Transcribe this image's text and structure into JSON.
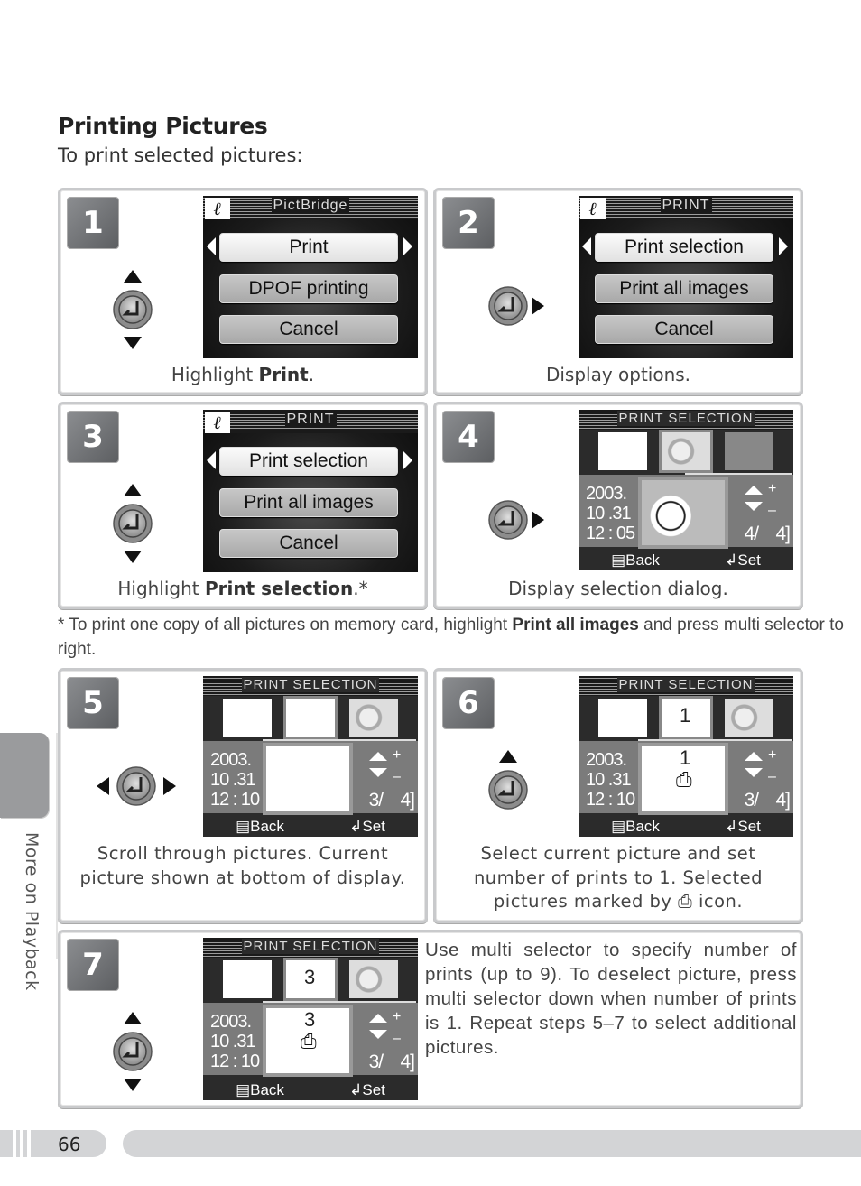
{
  "page": {
    "title": "Printing Pictures",
    "subtitle": "To print selected pictures:",
    "side_tab_label": "More on Playback",
    "page_number": "66"
  },
  "icons": {
    "pictbridge_logo": "pictbridge-icon",
    "multi_selector": "multi-selector-icon",
    "print_mark_glyph": "⎙",
    "back_glyph": "▤",
    "set_glyph": "↵"
  },
  "steps": [
    {
      "number": "1",
      "selector_arrows": [
        "up",
        "down"
      ],
      "screen": {
        "header": "PictBridge",
        "items": [
          "Print",
          "DPOF printing",
          "Cancel"
        ],
        "selected": 0
      },
      "caption_pre": "Highlight ",
      "caption_bold": "Print",
      "caption_post": "."
    },
    {
      "number": "2",
      "selector_arrows": [
        "right"
      ],
      "screen": {
        "header": "PRINT",
        "items": [
          "Print selection",
          "Print all images",
          "Cancel"
        ],
        "selected": 0
      },
      "caption_pre": "Display options.",
      "caption_bold": "",
      "caption_post": ""
    },
    {
      "number": "3",
      "selector_arrows": [
        "up",
        "down"
      ],
      "screen": {
        "header": "PRINT",
        "items": [
          "Print selection",
          "Print all images",
          "Cancel"
        ],
        "selected": 0
      },
      "caption_pre": "Highlight ",
      "caption_bold": "Print selection",
      "caption_post": ".*"
    },
    {
      "number": "4",
      "selector_arrows": [
        "right"
      ],
      "screen": {
        "header": "PRINT SELECTION",
        "date": "2003.",
        "md": "10 .31",
        "time": "12 : 05",
        "frame": "4/",
        "total": "4]",
        "count": "",
        "back": "Back",
        "set": "Set"
      },
      "caption_pre": "Display selection dialog.",
      "caption_bold": "",
      "caption_post": ""
    },
    {
      "number": "5",
      "selector_arrows": [
        "left",
        "right"
      ],
      "screen": {
        "header": "PRINT SELECTION",
        "date": "2003.",
        "md": "10 .31",
        "time": "12 : 10",
        "frame": "3/",
        "total": "4]",
        "count": "",
        "back": "Back",
        "set": "Set"
      },
      "caption": "Scroll through pictures.  Current picture shown at bottom of display."
    },
    {
      "number": "6",
      "selector_arrows": [
        "up"
      ],
      "screen": {
        "header": "PRINT SELECTION",
        "date": "2003.",
        "md": "10 .31",
        "time": "12 : 10",
        "frame": "3/",
        "total": "4]",
        "count": "1",
        "back": "Back",
        "set": "Set"
      },
      "caption_pre": "Select current picture and set number of prints to 1.  Selected pictures marked by ",
      "caption_post": " icon."
    },
    {
      "number": "7",
      "selector_arrows": [
        "up",
        "down"
      ],
      "screen": {
        "header": "PRINT SELECTION",
        "date": "2003.",
        "md": "10 .31",
        "time": "12 : 10",
        "frame": "3/",
        "total": "4]",
        "count": "3",
        "back": "Back",
        "set": "Set"
      },
      "caption": "Use multi selector to specify number of prints (up to 9).  To deselect picture, press multi selector down when number of prints is 1.  Repeat steps 5–7 to select additional pictures."
    }
  ],
  "footnote": {
    "pre": "* To print one copy of all pictures on memory card, highlight ",
    "bold": "Print all images",
    "post": " and press multi selector to right."
  }
}
